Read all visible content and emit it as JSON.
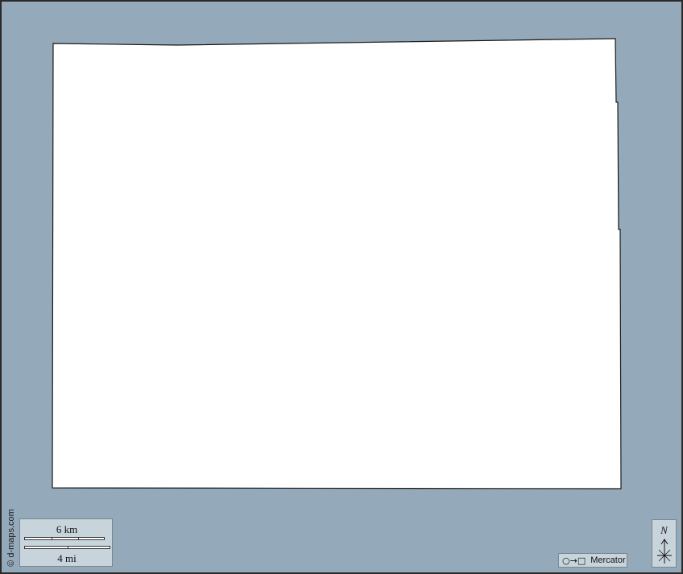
{
  "map": {
    "background_color": "#94a9b9",
    "land_color": "#ffffff",
    "border_color": "#1a1a1a",
    "credit": "© d-maps.com"
  },
  "scale": {
    "km_label": "6 km",
    "mi_label": "4 mi"
  },
  "projection": {
    "icon": "circle-to-square-icon",
    "label": "Mercator"
  },
  "north": {
    "letter": "N",
    "icon": "north-arrow-icon"
  }
}
